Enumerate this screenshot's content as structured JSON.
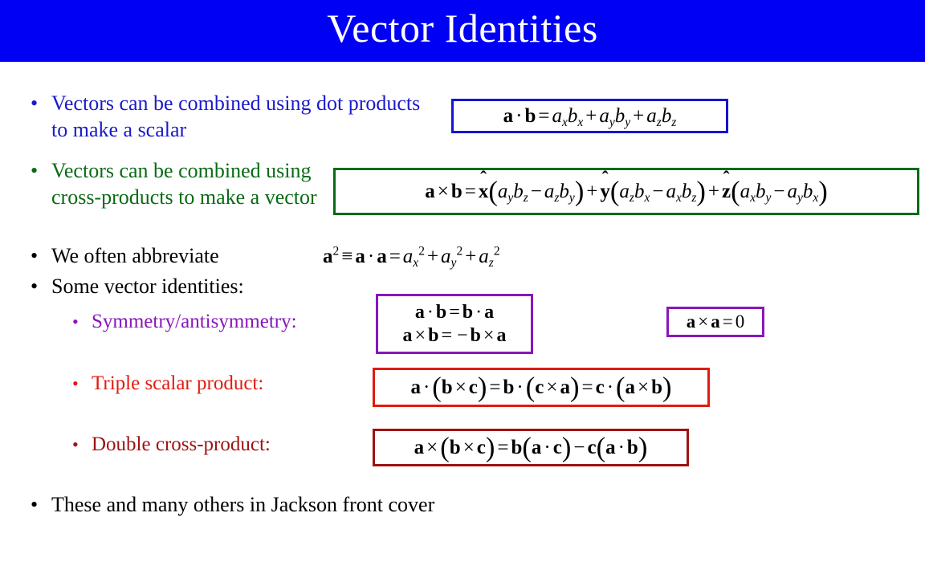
{
  "slide": {
    "title": "Vector Identities",
    "title_bg_color": "#0000F5",
    "title_text_color": "#FFFFFF",
    "background_color": "#FFFFFF",
    "bullet_glyph": "•"
  },
  "bullets": [
    {
      "id": "dot-product",
      "level": 1,
      "text": "Vectors can be combined using dot products to make a scalar",
      "color": "#1A1ACC"
    },
    {
      "id": "cross-product",
      "level": 1,
      "text": "Vectors can be combined using cross-products to make a vector",
      "color": "#0A6B15"
    },
    {
      "id": "abbreviate",
      "level": 1,
      "text": "We often abbreviate",
      "color": "#000000"
    },
    {
      "id": "identities-intro",
      "level": 1,
      "text": "Some vector identities:",
      "color": "#000000"
    },
    {
      "id": "symmetry",
      "level": 2,
      "text": "Symmetry/antisymmetry:",
      "color": "#8A16BB"
    },
    {
      "id": "triple-scalar",
      "level": 2,
      "text": "Triple scalar product:",
      "color": "#E01B10"
    },
    {
      "id": "double-cross",
      "level": 2,
      "text": "Double cross-product:",
      "color": "#9D1212"
    },
    {
      "id": "jackson-cover",
      "level": 1,
      "text": "These and many others in Jackson front cover",
      "color": "#000000"
    }
  ],
  "equations": [
    {
      "id": "dot-product-eq",
      "plain": "a · b = a_x b_x + a_y b_y + a_z b_z",
      "border_color": "#1414CF"
    },
    {
      "id": "cross-product-eq",
      "plain": "a × b = x̂ ( a_y b_z − a_z b_y ) + ŷ ( a_z b_x − a_x b_z ) + ẑ ( a_x b_y − a_y b_x )",
      "border_color": "#0A6B15"
    },
    {
      "id": "a-squared-eq",
      "plain": "a² ≡ a · a = a_x² + a_y² + a_z²",
      "border_color": "none"
    },
    {
      "id": "symmetry-eq-1",
      "plain": "a · b = b · a",
      "border_color": "#8A16BB"
    },
    {
      "id": "symmetry-eq-2",
      "plain": "a × b = −b × a",
      "border_color": "#8A16BB"
    },
    {
      "id": "self-cross-eq",
      "plain": "a × a = 0",
      "border_color": "#8A16BB"
    },
    {
      "id": "triple-scalar-eq",
      "plain": "a · ( b × c ) = b · ( c × a ) = c · ( a × b )",
      "border_color": "#E01B10"
    },
    {
      "id": "double-cross-eq",
      "plain": "a × ( b × c ) = b ( a · c ) − c ( a · b )",
      "border_color": "#9D1212"
    }
  ]
}
